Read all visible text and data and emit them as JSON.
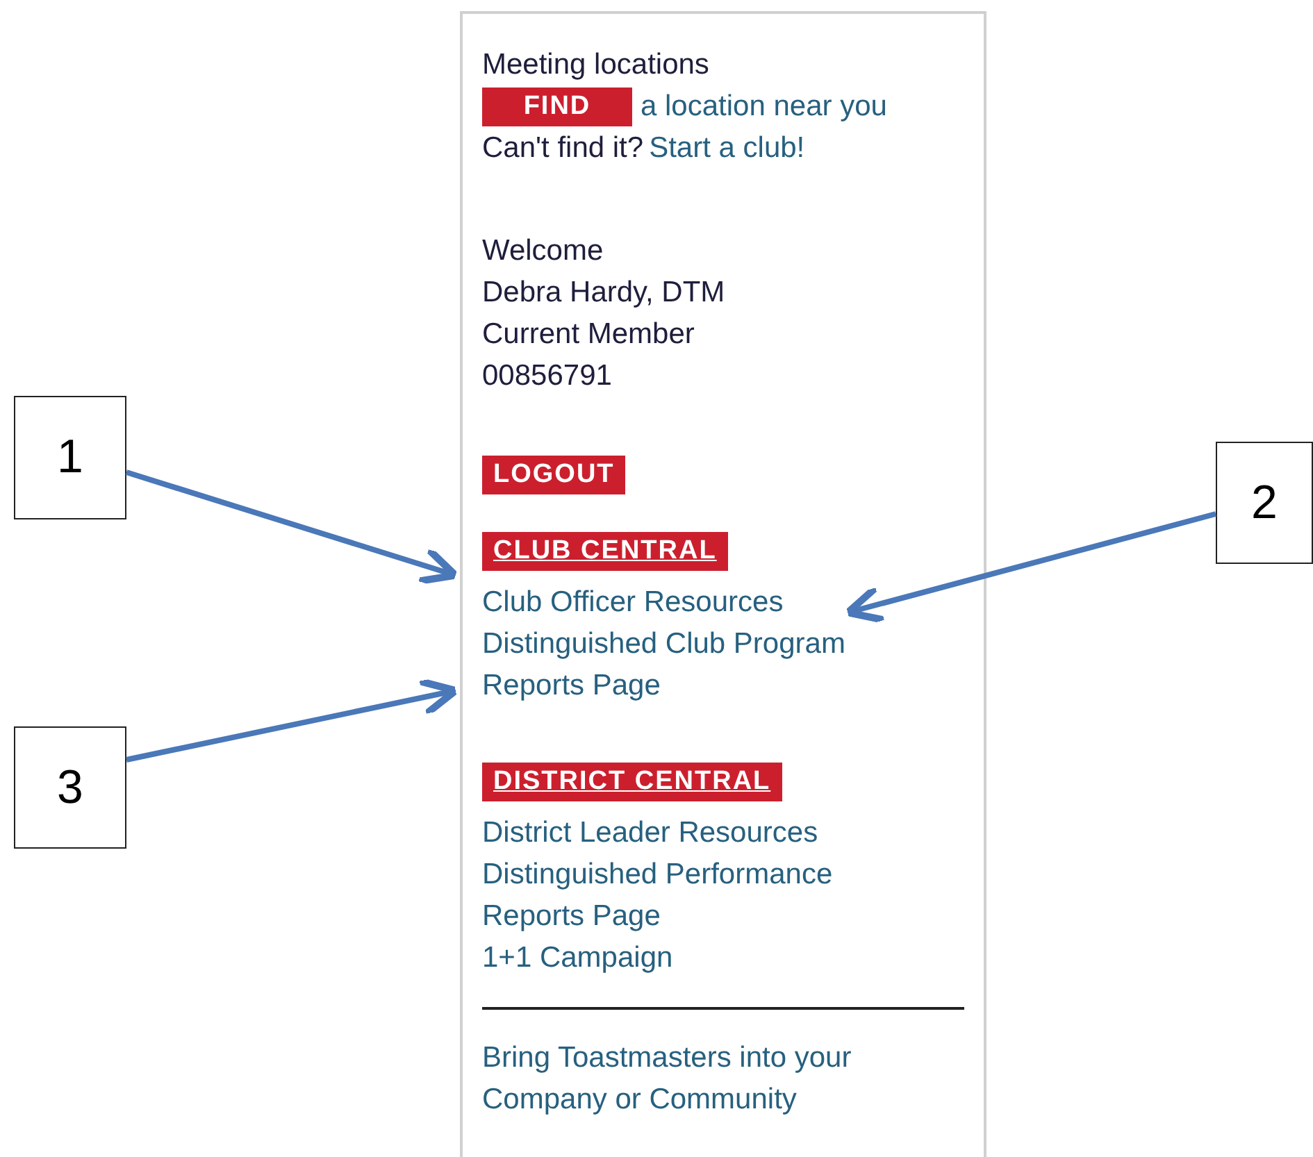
{
  "panel": {
    "meeting": {
      "title": "Meeting locations",
      "find_button": "FIND",
      "find_text": "a location near you",
      "prompt": "Can't find it?",
      "start_link": "Start a club!"
    },
    "welcome": [
      "Welcome",
      "Debra Hardy, DTM",
      "Current Member",
      "00856791"
    ],
    "logout_button": "LOGOUT",
    "sections": [
      {
        "heading": "CLUB CENTRAL",
        "links": [
          [
            "Club Officer Resources"
          ],
          [
            "Distinguished Club Program",
            "Reports Page"
          ]
        ]
      },
      {
        "heading": "DISTRICT CENTRAL",
        "links": [
          [
            "District Leader Resources"
          ],
          [
            "Distinguished Performance",
            "Reports Page"
          ],
          [
            "1+1 Campaign"
          ]
        ]
      }
    ],
    "footer_link": [
      "Bring Toastmasters into your",
      "Company or Community"
    ]
  },
  "callouts": [
    {
      "number": "1"
    },
    {
      "number": "2"
    },
    {
      "number": "3"
    }
  ]
}
